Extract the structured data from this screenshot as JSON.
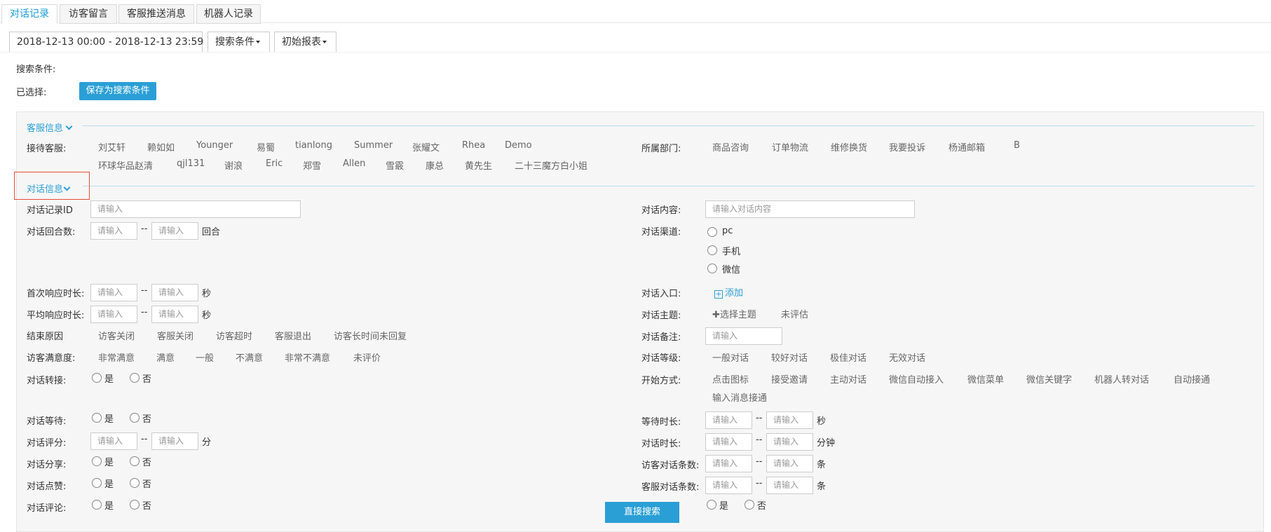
{
  "tabs": [
    "对话记录",
    "访客留言",
    "客服推送消息",
    "机器人记录"
  ],
  "toolbar": {
    "date_range": "2018-12-13 00:00  -  2018-12-13 23:59",
    "search_conditions": "搜索条件",
    "initial_report": "初始报表"
  },
  "filters": {
    "search_label": "搜索条件:",
    "selected_label": "已选择:",
    "save_button": "保存为搜索条件"
  },
  "agent_section": {
    "title": "客服信息",
    "agents_label": "接待客服:",
    "agents": [
      "刘艾轩",
      "赖如如",
      "Younger",
      "易蜀",
      "tianlong",
      "Summer",
      "张耀文",
      "Rhea",
      "Demo",
      "环球华品赵清",
      "qjl131",
      "谢浪",
      "Eric",
      "郑雪",
      "Allen",
      "雪霰",
      "康总",
      "黄先生",
      "二十三魔方白小姐"
    ],
    "dept_label": "所属部门:",
    "departments": [
      "商品咨询",
      "订单物流",
      "维修换货",
      "我要投诉",
      "杨通邮箱",
      "B"
    ]
  },
  "chat_section": {
    "title": "对话信息",
    "placeholder": "请输入",
    "record_id_label": "对话记录ID",
    "rounds_label": "对话回合数:",
    "rounds_unit": "回合",
    "first_resp_label": "首次响应时长:",
    "avg_resp_label": "平均响应时长:",
    "seconds_unit": "秒",
    "end_reason_label": "结束原因",
    "end_reasons": [
      "访客关闭",
      "客服关闭",
      "访客超时",
      "客服退出",
      "访客长时间未回复"
    ],
    "satisfaction_label": "访客满意度:",
    "satisfaction": [
      "非常满意",
      "满意",
      "一般",
      "不满意",
      "非常不满意",
      "未评价"
    ],
    "transfer_label": "对话转接:",
    "wait_label": "对话等待:",
    "rating_label": "对话评分:",
    "rating_unit": "分",
    "share_label": "对话分享:",
    "like_label": "对话点赞:",
    "comment_label": "对话评论:",
    "yes": "是",
    "no": "否",
    "content_label": "对话内容:",
    "content_placeholder": "请输入对话内容",
    "channel_label": "对话渠道:",
    "channels": [
      "pc",
      "手机",
      "微信"
    ],
    "entry_label": "对话入口:",
    "entry_add": "添加",
    "topic_label": "对话主题:",
    "topic_select": "选择主题",
    "topic_unrated": "未评估",
    "note_label": "对话备注:",
    "level_label": "对话等级:",
    "levels": [
      "一般对话",
      "较好对话",
      "极佳对话",
      "无效对话"
    ],
    "start_label": "开始方式:",
    "start_methods": [
      "点击图标",
      "接受邀请",
      "主动对话",
      "微信自动接入",
      "微信菜单",
      "微信关键字",
      "机器人转对话",
      "自动接通",
      "输入消息接通"
    ],
    "wait_time_label": "等待时长:",
    "duration_label": "对话时长:",
    "minutes_unit": "分钟",
    "visitor_msgs_label": "访客对话条数:",
    "agent_msgs_label": "客服对话条数:",
    "msgs_unit": "条"
  },
  "actions": {
    "search_button": "直接搜索"
  }
}
